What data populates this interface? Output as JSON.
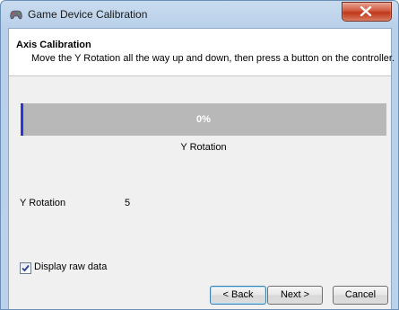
{
  "window": {
    "title": "Game Device Calibration",
    "icon": "game-controller-icon",
    "close_icon": "close-icon"
  },
  "header": {
    "title": "Axis Calibration",
    "instruction": "Move the Y Rotation all the way up and down, then press a button on the controller."
  },
  "progress": {
    "percent_text": "0%",
    "value": 0,
    "axis_caption": "Y Rotation"
  },
  "raw": {
    "label": "Y Rotation",
    "value": "5"
  },
  "options": {
    "display_raw_label": "Display raw data",
    "display_raw_checked": true
  },
  "buttons": {
    "back": "< Back",
    "next": "Next >",
    "cancel": "Cancel"
  },
  "colors": {
    "progress_track": "#b8b8b8",
    "progress_marker": "#2a36d8",
    "close_button": "#c0391b"
  }
}
